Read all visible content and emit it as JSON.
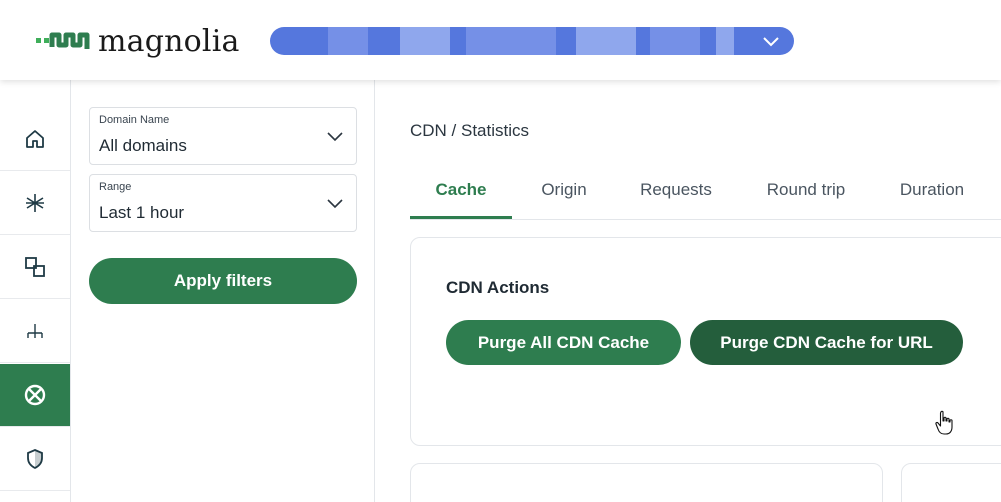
{
  "header": {
    "brand": "magnolia",
    "site_selector": {
      "value": ""
    }
  },
  "rail": {
    "items": [
      {
        "id": "home",
        "icon": "home-icon"
      },
      {
        "id": "asterisk",
        "icon": "asterisk-icon"
      },
      {
        "id": "apps",
        "icon": "overlapping-squares-icon"
      },
      {
        "id": "tree",
        "icon": "hierarchy-icon"
      },
      {
        "id": "cdn",
        "icon": "ban-circle-icon",
        "active": true
      },
      {
        "id": "security",
        "icon": "shield-icon"
      }
    ]
  },
  "filters": {
    "domain": {
      "label": "Domain Name",
      "value": "All domains"
    },
    "range": {
      "label": "Range",
      "value": "Last 1 hour"
    },
    "apply_label": "Apply filters"
  },
  "main": {
    "breadcrumb": "CDN / Statistics",
    "tabs": [
      {
        "label": "Cache",
        "active": true
      },
      {
        "label": "Origin"
      },
      {
        "label": "Requests"
      },
      {
        "label": "Round trip"
      },
      {
        "label": "Duration"
      }
    ],
    "actions_card": {
      "title": "CDN Actions",
      "purge_all_label": "Purge All CDN Cache",
      "purge_url_label": "Purge CDN Cache for URL"
    }
  },
  "colors": {
    "accent_green": "#2e7d4f",
    "dark_green": "#245e3c",
    "selector_blue": "#5577dd"
  }
}
